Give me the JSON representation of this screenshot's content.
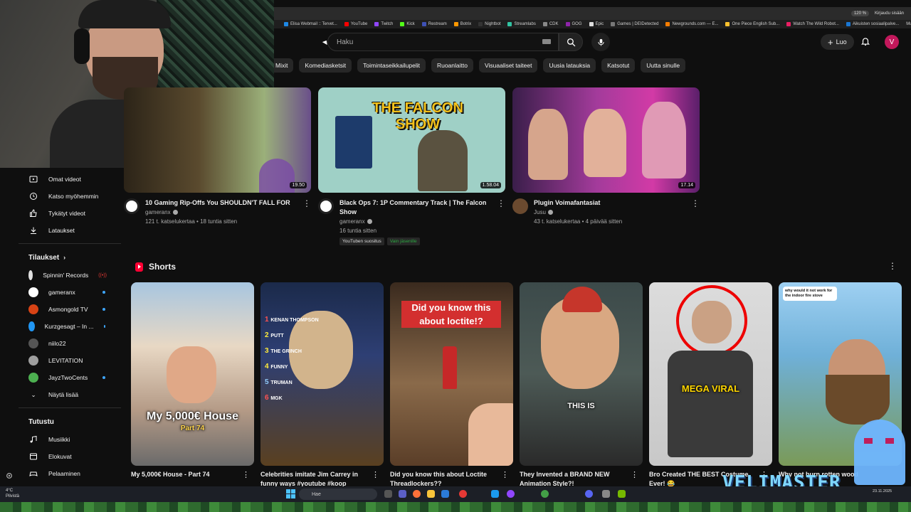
{
  "browser": {
    "zoom": "120 %",
    "login_text": "Kirjaudu sisään",
    "bookmarks": [
      {
        "label": "Elisa Webmail :: Tervet...",
        "color": "#1e88e5"
      },
      {
        "label": "YouTube",
        "color": "#ff0000"
      },
      {
        "label": "Twitch",
        "color": "#9146ff"
      },
      {
        "label": "Kick",
        "color": "#53fc18"
      },
      {
        "label": "Restream",
        "color": "#3f51b5"
      },
      {
        "label": "Botrix",
        "color": "#ff9800"
      },
      {
        "label": "Nightbot",
        "color": "#333333"
      },
      {
        "label": "Streamlabs",
        "color": "#31c3a2"
      },
      {
        "label": "CDK",
        "color": "#888888"
      },
      {
        "label": "GOG",
        "color": "#8e24aa"
      },
      {
        "label": "Epic",
        "color": "#dddddd"
      },
      {
        "label": "Games | DEIDetected",
        "color": "#777777"
      },
      {
        "label": "Newgrounds.com — E...",
        "color": "#f57c00"
      },
      {
        "label": "One Piece English Sub...",
        "color": "#fbc02d"
      },
      {
        "label": "Watch The Wild Robot...",
        "color": "#e91e63"
      },
      {
        "label": "Aikuisten sosiaalipalve...",
        "color": "#1976d2"
      }
    ],
    "other_bookmarks": "Muut kirjanmerkit"
  },
  "topbar": {
    "search_placeholder": "Haku",
    "create_label": "Luo",
    "avatar_letter": "V"
  },
  "chips": [
    "Mixit",
    "Komediasketsit",
    "Toimintaseikkailupelit",
    "Ruoanlaitto",
    "Visuaaliset taiteet",
    "Uusia latauksia",
    "Katsotut",
    "Uutta sinulle"
  ],
  "sidebar": {
    "you_items": [
      {
        "label": "Omat videot",
        "icon": "my-videos-icon"
      },
      {
        "label": "Katso myöhemmin",
        "icon": "clock-icon"
      },
      {
        "label": "Tykätyt videot",
        "icon": "thumbs-up-icon"
      },
      {
        "label": "Lataukset",
        "icon": "download-icon"
      }
    ],
    "subscriptions_title": "Tilaukset",
    "subscriptions": [
      {
        "label": "Spinnin' Records",
        "color": "#e0e0e0",
        "status": "live"
      },
      {
        "label": "gameranx",
        "color": "#ffffff",
        "status": "dot"
      },
      {
        "label": "Asmongold TV",
        "color": "#d84315",
        "status": "dot"
      },
      {
        "label": "Kurzgesagt – In ...",
        "color": "#2196f3",
        "status": "dot"
      },
      {
        "label": "niilo22",
        "color": "#555555",
        "status": "none"
      },
      {
        "label": "LEVITATION",
        "color": "#9e9e9e",
        "status": "none"
      },
      {
        "label": "JayzTwoCents",
        "color": "#4caf50",
        "status": "dot"
      }
    ],
    "show_more": "Näytä lisää",
    "explore_title": "Tutustu",
    "explore": [
      {
        "label": "Musiikki",
        "icon": "music-note-icon"
      },
      {
        "label": "Elokuvat",
        "icon": "film-icon"
      },
      {
        "label": "Pelaaminen",
        "icon": "gamepad-icon"
      }
    ]
  },
  "videos": [
    {
      "title": "10 Gaming Rip-Offs You SHOULDN'T FALL FOR",
      "channel": "gameranx",
      "meta": "121 t. katselukertaa • 18 tuntia sitten",
      "duration": "19.50"
    },
    {
      "title": "Black Ops 7: 1P Commentary Track | The Falcon Show",
      "channel": "gameranx",
      "meta": "16 tuntia sitten",
      "duration": "1.58.04",
      "thumb_text": "THE FALCON SHOW",
      "badges": [
        "YouTuben suositus",
        "Vain jäsenille"
      ]
    },
    {
      "title": "Plugin Voimafantasiat",
      "channel": "Jusu",
      "meta": "43 t. katselukertaa • 4 päivää sitten",
      "duration": "17.14"
    }
  ],
  "shorts": {
    "title": "Shorts",
    "items": [
      {
        "title": "My 5,000€ House - Part 74",
        "overlay": "My 5,000€ House",
        "overlay2": "Part 74"
      },
      {
        "title": "Celebrities imitate Jim Carrey in funny ways #youtube #koop",
        "list": [
          "KENAN THOMPSON",
          "PUTT",
          "THE GRINCH",
          "FUNNY",
          "TRUMAN",
          "MGK"
        ]
      },
      {
        "title": "Did you know this about Loctite Threadlockers??",
        "overlay": "Did you know this about loctite!?"
      },
      {
        "title": "They Invented a BRAND NEW Animation Style?!",
        "overlay": "THIS IS"
      },
      {
        "title": "Bro Created THE BEST Costume Ever! 😂",
        "overlay": "MEGA VIRAL"
      },
      {
        "title": "Why not burn rotten wood",
        "overlay": "why would it not work for the indoor fire stove"
      }
    ]
  },
  "taskbar": {
    "weather_temp": "4°C",
    "weather_desc": "Pilvistä",
    "search": "Hae",
    "date": "23.11.2025"
  },
  "watermark": "VELIMASTER"
}
